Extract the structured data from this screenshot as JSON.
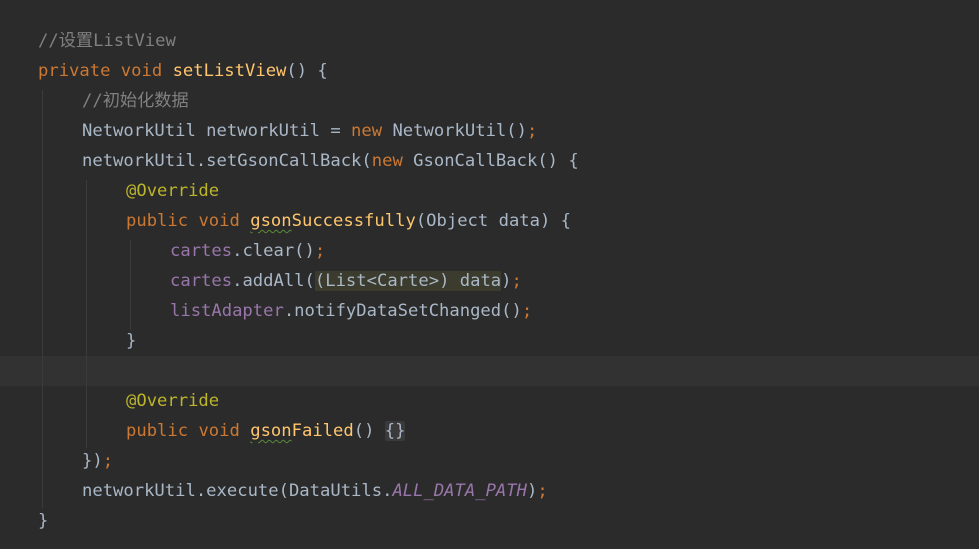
{
  "editor": {
    "lines": [
      {
        "indent": 0,
        "tokens": [
          {
            "t": "//设置ListView",
            "c": "cm"
          }
        ]
      },
      {
        "indent": 0,
        "tokens": [
          {
            "t": "private",
            "c": "kw"
          },
          {
            "t": " ",
            "c": ""
          },
          {
            "t": "void",
            "c": "kw"
          },
          {
            "t": " ",
            "c": ""
          },
          {
            "t": "setListView",
            "c": "fn"
          },
          {
            "t": "() {",
            "c": ""
          }
        ]
      },
      {
        "indent": 1,
        "tokens": [
          {
            "t": "//初始化数据",
            "c": "cm"
          }
        ]
      },
      {
        "indent": 1,
        "tokens": [
          {
            "t": "NetworkUtil networkUtil = ",
            "c": ""
          },
          {
            "t": "new",
            "c": "kw"
          },
          {
            "t": " NetworkUtil()",
            "c": ""
          },
          {
            "t": ";",
            "c": "semi"
          }
        ]
      },
      {
        "indent": 1,
        "tokens": [
          {
            "t": "networkUtil.setGsonCallBack(",
            "c": ""
          },
          {
            "t": "new",
            "c": "kw"
          },
          {
            "t": " GsonCallBack() {",
            "c": ""
          }
        ]
      },
      {
        "indent": 2,
        "tokens": [
          {
            "t": "@Override",
            "c": "ann"
          }
        ]
      },
      {
        "indent": 2,
        "tokens": [
          {
            "t": "public",
            "c": "kw"
          },
          {
            "t": " ",
            "c": ""
          },
          {
            "t": "void",
            "c": "kw"
          },
          {
            "t": " ",
            "c": ""
          },
          {
            "t": "gson",
            "c": "fn squiggle"
          },
          {
            "t": "Successfully",
            "c": "fn"
          },
          {
            "t": "(Object data) {",
            "c": ""
          }
        ]
      },
      {
        "indent": 3,
        "tokens": [
          {
            "t": "cartes",
            "c": "field"
          },
          {
            "t": ".clear()",
            "c": ""
          },
          {
            "t": ";",
            "c": "semi"
          }
        ]
      },
      {
        "indent": 3,
        "tokens": [
          {
            "t": "cartes",
            "c": "field"
          },
          {
            "t": ".addAll(",
            "c": ""
          },
          {
            "t": "(List<Carte>) data",
            "c": "hl-cast"
          },
          {
            "t": ")",
            "c": ""
          },
          {
            "t": ";",
            "c": "semi"
          }
        ]
      },
      {
        "indent": 3,
        "tokens": [
          {
            "t": "listAdapter",
            "c": "field"
          },
          {
            "t": ".notifyDataSetChanged()",
            "c": ""
          },
          {
            "t": ";",
            "c": "semi"
          }
        ]
      },
      {
        "indent": 2,
        "tokens": [
          {
            "t": "}",
            "c": ""
          }
        ]
      },
      {
        "indent": 0,
        "tokens": []
      },
      {
        "indent": 2,
        "tokens": [
          {
            "t": "@Override",
            "c": "ann"
          }
        ]
      },
      {
        "indent": 2,
        "tokens": [
          {
            "t": "public",
            "c": "kw"
          },
          {
            "t": " ",
            "c": ""
          },
          {
            "t": "void",
            "c": "kw"
          },
          {
            "t": " ",
            "c": ""
          },
          {
            "t": "gson",
            "c": "fn squiggle"
          },
          {
            "t": "Failed",
            "c": "fn"
          },
          {
            "t": "() ",
            "c": ""
          },
          {
            "t": "{}",
            "c": "hl-braces"
          }
        ]
      },
      {
        "indent": 1,
        "tokens": [
          {
            "t": "})",
            "c": ""
          },
          {
            "t": ";",
            "c": "semi"
          }
        ]
      },
      {
        "indent": 1,
        "tokens": [
          {
            "t": "networkUtil.execute(DataUtils.",
            "c": ""
          },
          {
            "t": "ALL_DATA_PATH",
            "c": "const"
          },
          {
            "t": ")",
            "c": ""
          },
          {
            "t": ";",
            "c": "semi"
          }
        ]
      },
      {
        "indent": 0,
        "tokens": [
          {
            "t": "}",
            "c": ""
          }
        ]
      }
    ]
  },
  "colors": {
    "background": "#2b2b2b",
    "current_line": "#323232",
    "keyword": "#cc7832",
    "comment": "#808080",
    "method": "#ffc66d",
    "field": "#9876aa",
    "annotation": "#bbb529",
    "text": "#a9b7c6"
  }
}
